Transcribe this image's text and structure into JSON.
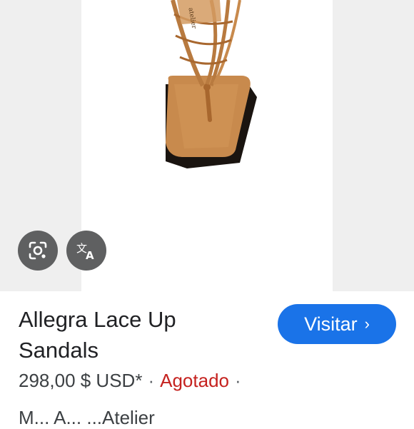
{
  "product": {
    "title": "Allegra Lace Up Sandals",
    "price": "298,00 $ USD*",
    "separator": "·",
    "stock_status": "Agotado",
    "seller_partial": "M... A... ...Atelier"
  },
  "actions": {
    "visit_label": "Visitar",
    "visit_chevron": "›"
  },
  "icons": {
    "lens": "google-lens-icon",
    "translate": "translate-icon"
  },
  "colors": {
    "accent": "#1a73e8",
    "stock_out": "#c5221f",
    "overlay": "#5f6061"
  }
}
